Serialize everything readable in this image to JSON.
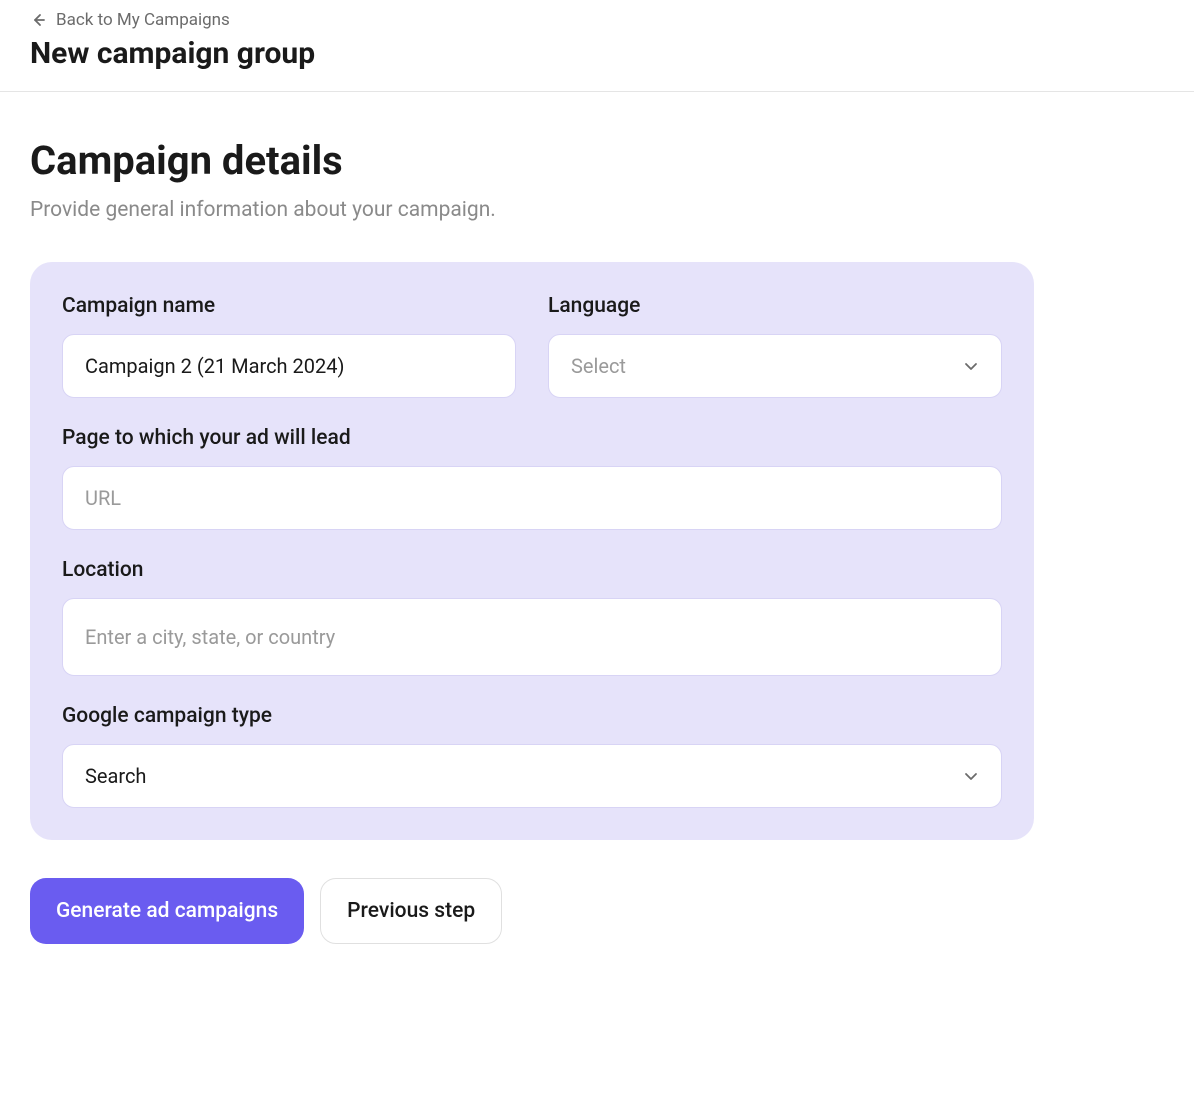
{
  "header": {
    "back_label": "Back to My Campaigns",
    "page_title": "New campaign group"
  },
  "section": {
    "title": "Campaign details",
    "subtitle": "Provide general information about your campaign."
  },
  "form": {
    "campaign_name": {
      "label": "Campaign name",
      "value": "Campaign 2 (21 March 2024)"
    },
    "language": {
      "label": "Language",
      "placeholder": "Select",
      "value": ""
    },
    "page_url": {
      "label": "Page to which your ad will lead",
      "placeholder": "URL",
      "value": ""
    },
    "location": {
      "label": "Location",
      "placeholder": "Enter a city, state, or country",
      "value": ""
    },
    "campaign_type": {
      "label": "Google campaign type",
      "value": "Search"
    }
  },
  "actions": {
    "generate_label": "Generate ad campaigns",
    "previous_label": "Previous step"
  },
  "colors": {
    "primary": "#6a5cf0",
    "card_bg": "#e6e3fa"
  }
}
